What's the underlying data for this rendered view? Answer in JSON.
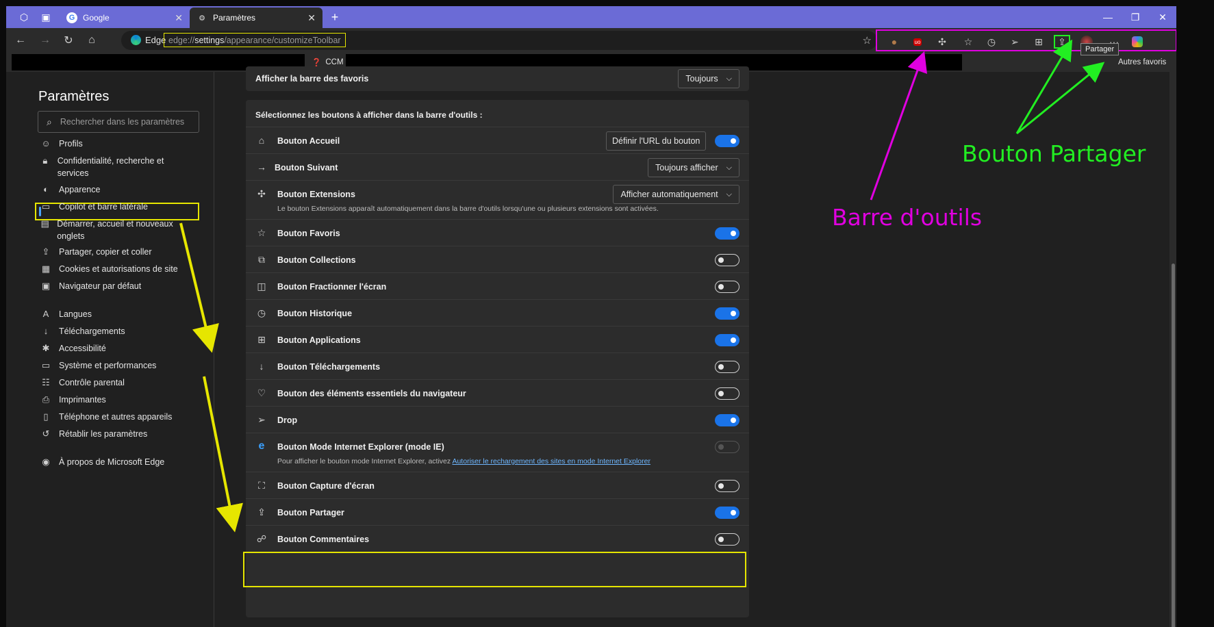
{
  "tabs": [
    {
      "title": "Google",
      "icon": "google-icon"
    },
    {
      "title": "Paramètres",
      "icon": "gear-icon"
    }
  ],
  "address": {
    "chip": "Edge",
    "url_prefix": "edge://",
    "url_host": "settings",
    "url_path": "/appearance/customizeToolbar"
  },
  "bookmarks": {
    "item": "CCM",
    "other": "Autres favoris"
  },
  "tooltip": "Partager",
  "sidebar": {
    "title": "Paramètres",
    "search_placeholder": "Rechercher dans les paramètres",
    "items": [
      {
        "label": "Profils",
        "icon": "profile-icon"
      },
      {
        "label": "Confidentialité, recherche et services",
        "icon": "lock-icon"
      },
      {
        "label": "Apparence",
        "icon": "palette-icon"
      },
      {
        "label": "Copilot et barre latérale",
        "icon": "sidebar-icon"
      },
      {
        "label": "Démarrer, accueil et nouveaux onglets",
        "icon": "home-tabs-icon"
      },
      {
        "label": "Partager, copier et coller",
        "icon": "share-icon"
      },
      {
        "label": "Cookies et autorisations de site",
        "icon": "cookie-icon"
      },
      {
        "label": "Navigateur par défaut",
        "icon": "browser-icon"
      },
      {
        "label": "Langues",
        "icon": "language-icon"
      },
      {
        "label": "Téléchargements",
        "icon": "download-icon"
      },
      {
        "label": "Accessibilité",
        "icon": "accessibility-icon"
      },
      {
        "label": "Système et performances",
        "icon": "laptop-icon"
      },
      {
        "label": "Contrôle parental",
        "icon": "family-icon"
      },
      {
        "label": "Imprimantes",
        "icon": "printer-icon"
      },
      {
        "label": "Téléphone et autres appareils",
        "icon": "phone-icon"
      },
      {
        "label": "Rétablir les paramètres",
        "icon": "reset-icon"
      },
      {
        "label": "À propos de Microsoft Edge",
        "icon": "edge-icon"
      }
    ]
  },
  "favbar_card": {
    "label": "Afficher la barre des favoris",
    "value": "Toujours"
  },
  "toolbar_card": {
    "heading": "Sélectionnez les boutons à afficher dans la barre d'outils :",
    "home": {
      "label": "Bouton Accueil",
      "button": "Définir l'URL du bouton",
      "on": true
    },
    "forward": {
      "label": "Bouton Suivant",
      "value": "Toujours afficher"
    },
    "extensions": {
      "label": "Bouton Extensions",
      "value": "Afficher automatiquement",
      "desc": "Le bouton Extensions apparaît automatiquement dans la barre d'outils lorsqu'une ou plusieurs extensions sont activées."
    },
    "rows": [
      {
        "label": "Bouton Favoris",
        "state": "on",
        "icon": "favorites-icon"
      },
      {
        "label": "Bouton Collections",
        "state": "off",
        "icon": "collections-icon"
      },
      {
        "label": "Bouton Fractionner l'écran",
        "state": "off",
        "icon": "split-screen-icon"
      },
      {
        "label": "Bouton Historique",
        "state": "on",
        "icon": "history-icon"
      },
      {
        "label": "Bouton Applications",
        "state": "on",
        "icon": "apps-icon"
      },
      {
        "label": "Bouton Téléchargements",
        "state": "off",
        "icon": "download-icon"
      },
      {
        "label": "Bouton des éléments essentiels du navigateur",
        "state": "off",
        "icon": "heart-pulse-icon"
      },
      {
        "label": "Drop",
        "state": "on",
        "icon": "send-icon"
      }
    ],
    "ie": {
      "label": "Bouton Mode Internet Explorer (mode IE)",
      "desc": "Pour afficher le bouton mode Internet Explorer, activez ",
      "link": "Autoriser le rechargement des sites en mode Internet Explorer"
    },
    "rows2": [
      {
        "label": "Bouton Capture d'écran",
        "state": "off",
        "icon": "screenshot-icon"
      },
      {
        "label": "Bouton Partager",
        "state": "on",
        "icon": "share-icon"
      },
      {
        "label": "Bouton Commentaires",
        "state": "off",
        "icon": "feedback-icon"
      }
    ]
  },
  "annotations": {
    "toolbar": "Barre d'outils",
    "share": "Bouton Partager",
    "colors": {
      "magenta": "#e000e0",
      "green": "#22ee22",
      "yellow": "#e6e600"
    }
  }
}
